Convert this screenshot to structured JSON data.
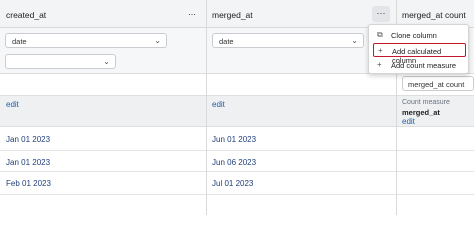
{
  "columns": [
    {
      "title": "created_at",
      "filter": "date",
      "edit": "edit",
      "values": [
        "Jan 01 2023",
        "Jan 01 2023",
        "Feb 01 2023"
      ]
    },
    {
      "title": "merged_at",
      "filter": "date",
      "edit": "edit",
      "values": [
        "Jun 01 2023",
        "Jun 06 2023",
        "Jul 01 2023"
      ]
    },
    {
      "title": "merged_at count",
      "input_value": "merged_at count",
      "measure_label": "Count measure",
      "measure_name": "merged_at",
      "edit": "edit"
    }
  ],
  "menu_glyph": "···",
  "context_menu": {
    "items": [
      {
        "label": "Clone column",
        "icon": "copy-icon"
      },
      {
        "label": "Add calculated column",
        "icon": "plus-icon"
      },
      {
        "label": "Add count measure",
        "icon": "plus-icon"
      }
    ]
  }
}
